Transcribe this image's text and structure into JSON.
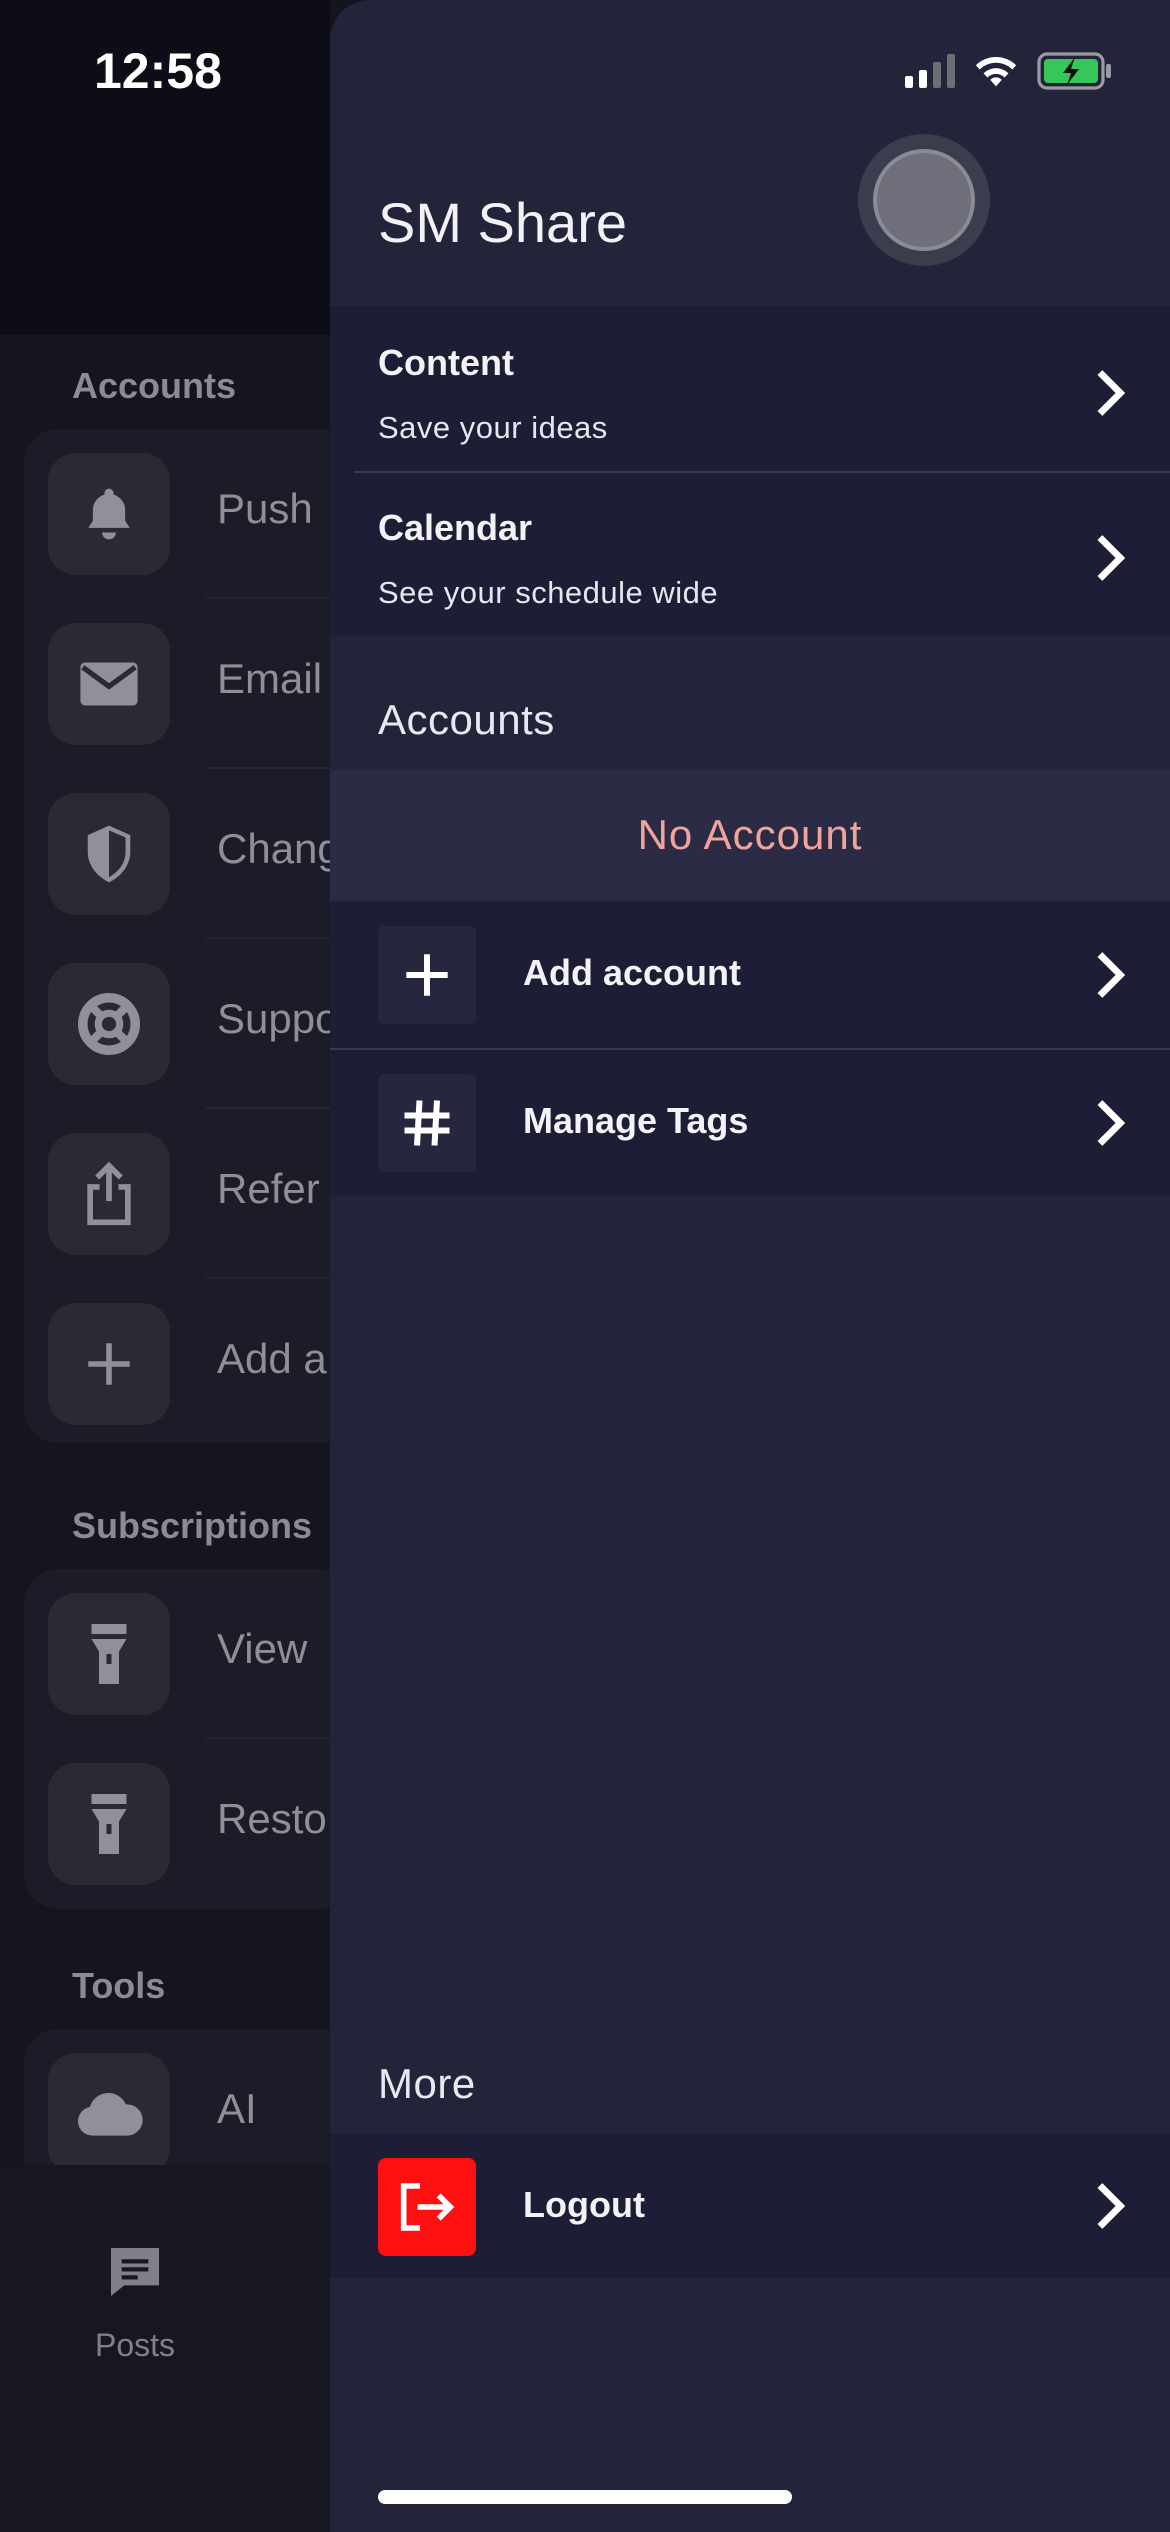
{
  "status_bar": {
    "time": "12:58"
  },
  "background_screen": {
    "sections": [
      {
        "title": "Accounts",
        "items": [
          {
            "label": "Push",
            "icon": "bell-icon"
          },
          {
            "label": "Email",
            "icon": "envelope-icon"
          },
          {
            "label": "Chang",
            "icon": "shield-icon"
          },
          {
            "label": "Suppo",
            "icon": "lifebuoy-icon"
          },
          {
            "label": "Refer",
            "icon": "share-icon"
          },
          {
            "label": "Add a",
            "icon": "plus-icon"
          }
        ]
      },
      {
        "title": "Subscriptions",
        "items": [
          {
            "label": "View",
            "icon": "flashlight-icon"
          },
          {
            "label": "Resto",
            "icon": "flashlight-icon"
          }
        ]
      },
      {
        "title": "Tools",
        "items": [
          {
            "label": "AI",
            "icon": "cloud-icon"
          }
        ]
      }
    ],
    "tab_bar": {
      "posts_label": "Posts"
    }
  },
  "drawer": {
    "title": "SM Share",
    "nav": [
      {
        "title": "Content",
        "subtitle": "Save your ideas"
      },
      {
        "title": "Calendar",
        "subtitle": "See your schedule wide"
      }
    ],
    "accounts": {
      "heading": "Accounts",
      "empty_text": "No Account",
      "add_label": "Add account",
      "tags_label": "Manage Tags"
    },
    "more": {
      "heading": "More",
      "logout_label": "Logout"
    }
  },
  "colors": {
    "accent_logout": "#ff1010",
    "no_account_text": "#f2a49a",
    "drawer_bg": "#23243a",
    "row_bg": "#1d1e36"
  }
}
